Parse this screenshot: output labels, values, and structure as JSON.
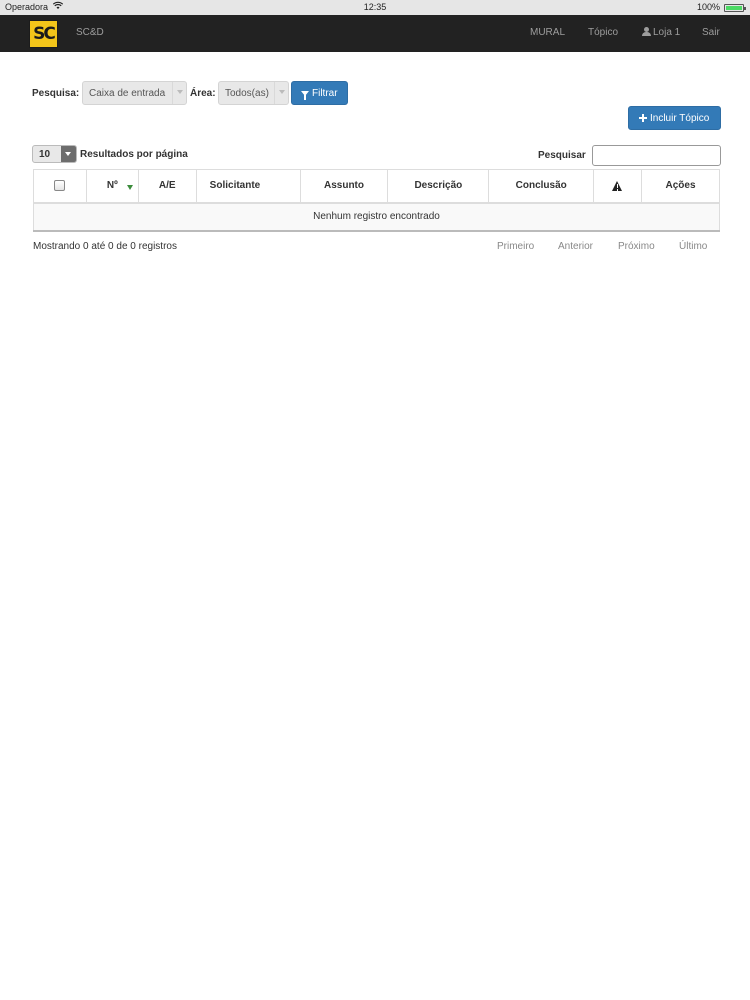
{
  "status_bar": {
    "carrier": "Operadora",
    "time": "12:35",
    "battery": "100%",
    "battery_level": 1.0
  },
  "navbar": {
    "logo_text": "SC",
    "brand": "SC&D",
    "items": {
      "mural": "MURAL",
      "topico": "Tópico",
      "user": "Loja 1",
      "exit": "Sair"
    }
  },
  "filters": {
    "search_label": "Pesquisa:",
    "search_value": "Caixa de entrada",
    "area_label": "Área:",
    "area_value": "Todos(as)",
    "filter_button": "Filtrar"
  },
  "actions": {
    "add_topic": "Incluir Tópico"
  },
  "table_controls": {
    "per_page_value": "10",
    "per_page_label": "Resultados por página",
    "search_label": "Pesquisar",
    "search_placeholder": ""
  },
  "table": {
    "columns": {
      "num": "Nº",
      "ae": "A/E",
      "solicitante": "Solicitante",
      "assunto": "Assunto",
      "descricao": "Descrição",
      "conclusao": "Conclusão",
      "acoes": "Ações"
    },
    "empty_message": "Nenhum registro encontrado"
  },
  "footer": {
    "info": "Mostrando 0 até 0 de 0 registros",
    "pager": {
      "first": "Primeiro",
      "prev": "Anterior",
      "next": "Próximo",
      "last": "Último"
    }
  },
  "colors": {
    "navbar": "#222222",
    "primary": "#337ab7",
    "logo": "#f3c51a"
  }
}
